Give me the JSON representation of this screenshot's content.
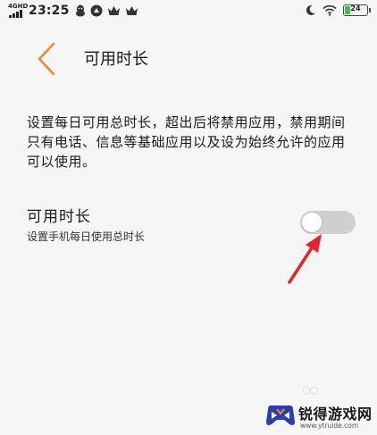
{
  "status_bar": {
    "network_label": "4GHD",
    "time": "23:25",
    "battery_level": "24",
    "battery_fraction": 0.24,
    "battery_color": "#35c24a"
  },
  "header": {
    "title": "可用时长"
  },
  "description": "设置每日可用总时长，超出后将禁用应用，禁用期间只有电话、信息等基础应用以及设为始终允许的应用可以使用。",
  "setting": {
    "title": "可用时长",
    "subtitle": "设置手机每日使用总时长",
    "enabled": false
  },
  "colors": {
    "accent": "#f0872a",
    "annotation": "#e3242b",
    "toggle_off": "#cfcfcf"
  },
  "watermark": {
    "name": "锐得游戏网",
    "url": "www.ytruide.com"
  }
}
